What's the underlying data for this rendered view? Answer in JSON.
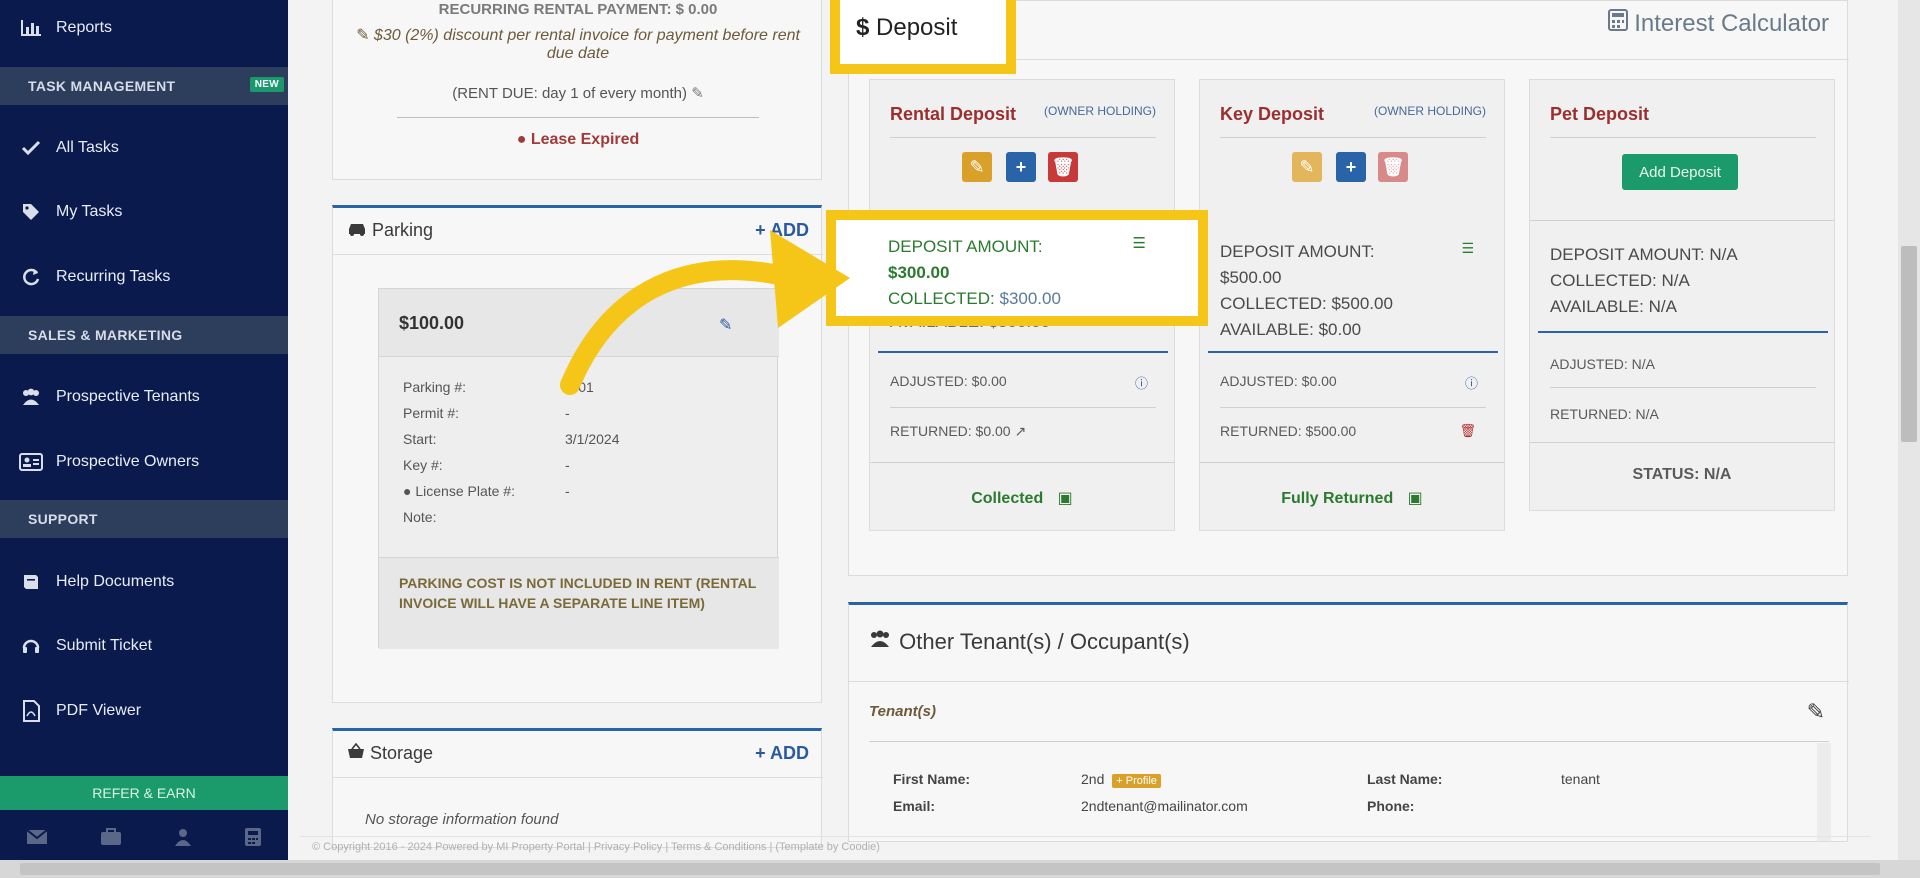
{
  "sidebar": {
    "reports": "Reports",
    "section_task": "TASK MANAGEMENT",
    "new_badge": "NEW",
    "all_tasks": "All Tasks",
    "my_tasks": "My Tasks",
    "recurring_tasks": "Recurring Tasks",
    "section_sales": "SALES & MARKETING",
    "prospective_tenants": "Prospective Tenants",
    "prospective_owners": "Prospective Owners",
    "section_support": "SUPPORT",
    "help_documents": "Help Documents",
    "submit_ticket": "Submit Ticket",
    "pdf_viewer": "PDF Viewer",
    "refer_earn": "REFER & EARN"
  },
  "lease": {
    "recurring_payment": "RECURRING RENTAL PAYMENT: $ 0.00",
    "discount": "$30 (2%) discount per rental invoice for payment before rent due date",
    "rent_due": "(RENT DUE: day 1 of every month)",
    "status": "Lease Expired"
  },
  "parking": {
    "title": "Parking",
    "add": "ADD",
    "amount": "$100.00",
    "labels": [
      "Parking #:",
      "Permit #:",
      "Start:",
      "Key #:",
      "License Plate #:",
      "Note:"
    ],
    "values": [
      "Z-01",
      "-",
      "3/1/2024",
      "-",
      "-",
      ""
    ],
    "notice": "PARKING COST IS NOT INCLUDED IN RENT (RENTAL INVOICE WILL HAVE A SEPARATE LINE ITEM)"
  },
  "storage": {
    "title": "Storage",
    "add": "ADD",
    "empty": "No storage information found"
  },
  "deposit_tab": "Deposit",
  "interest_calculator": "Interest Calculator",
  "deposits": {
    "rental": {
      "title": "Rental Deposit",
      "holding": "(OWNER HOLDING)",
      "amount_label": "DEPOSIT AMOUNT:",
      "amount": "$300.00",
      "collected_label": "COLLECTED:",
      "collected": "$300.00",
      "available": "AVAILABLE: $300.00",
      "adjusted": "ADJUSTED: $0.00",
      "returned": "RETURNED: $0.00",
      "status": "Collected"
    },
    "key": {
      "title": "Key Deposit",
      "holding": "(OWNER HOLDING)",
      "amount": "DEPOSIT AMOUNT:",
      "amount_value": "$500.00",
      "collected": "COLLECTED: $500.00",
      "available": "AVAILABLE: $0.00",
      "adjusted": "ADJUSTED: $0.00",
      "returned": "RETURNED: $500.00",
      "status": "Fully Returned"
    },
    "pet": {
      "title": "Pet Deposit",
      "add_button": "Add Deposit",
      "amount": "DEPOSIT AMOUNT: N/A",
      "collected": "COLLECTED: N/A",
      "available": "AVAILABLE: N/A",
      "adjusted": "ADJUSTED: N/A",
      "returned": "RETURNED: N/A",
      "status": "STATUS: N/A"
    }
  },
  "occupants": {
    "title": "Other Tenant(s) / Occupant(s)",
    "tenants_label": "Tenant(s)",
    "first_name_label": "First Name:",
    "first_name": "2nd",
    "profile_badge": "+ Profile",
    "last_name_label": "Last Name:",
    "last_name": "tenant",
    "email_label": "Email:",
    "email": "2ndtenant@mailinator.com",
    "phone_label": "Phone:"
  },
  "footer": "© Copyright 2016 - 2024 Powered by MI Property Portal | Privacy Policy | Terms & Conditions | (Template by Coodie)"
}
